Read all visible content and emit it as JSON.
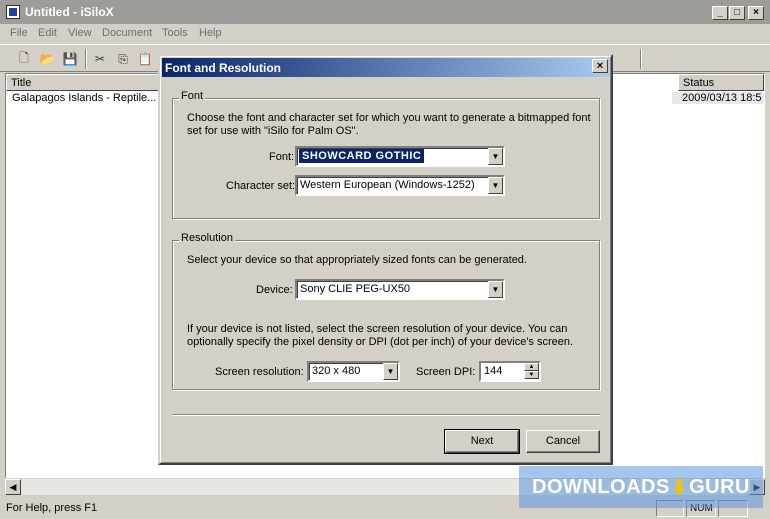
{
  "window": {
    "title": "Untitled - iSiloX",
    "min_icon": "minimize-icon",
    "max_icon": "maximize-icon",
    "close_icon": "close-icon"
  },
  "menu": [
    "File",
    "Edit",
    "View",
    "Document",
    "Tools",
    "Help"
  ],
  "list": {
    "columns": [
      "Title",
      "Status"
    ],
    "rows": [
      {
        "title": "Galapagos Islands - Reptile...",
        "status": "2009/03/13 18:5"
      }
    ]
  },
  "statusbar": {
    "text": "For Help, press F1",
    "num": "NUM"
  },
  "dialog": {
    "title": "Font and Resolution",
    "font_group": {
      "legend": "Font",
      "description": "Choose the font and character set for which you want to generate a bitmapped font set for use with \"iSilo for Palm OS\".",
      "font_label": "Font:",
      "font_value": "SHOWCARD GOTHIC",
      "charset_label": "Character set:",
      "charset_value": "Western European (Windows-1252)"
    },
    "resolution_group": {
      "legend": "Resolution",
      "description": "Select your device so that appropriately sized fonts can be generated.",
      "device_label": "Device:",
      "device_value": "Sony CLIE PEG-UX50",
      "note": "If your device is not listed, select the screen resolution of your device. You can optionally specify the pixel density or DPI (dot per inch) of your device's screen.",
      "res_label": "Screen resolution:",
      "res_value": "320 x 480",
      "dpi_label": "Screen DPI:",
      "dpi_value": "144"
    },
    "next_label": "Next",
    "cancel_label": "Cancel"
  },
  "watermark": {
    "left": "DOWNLOADS",
    "right": "GURU"
  }
}
